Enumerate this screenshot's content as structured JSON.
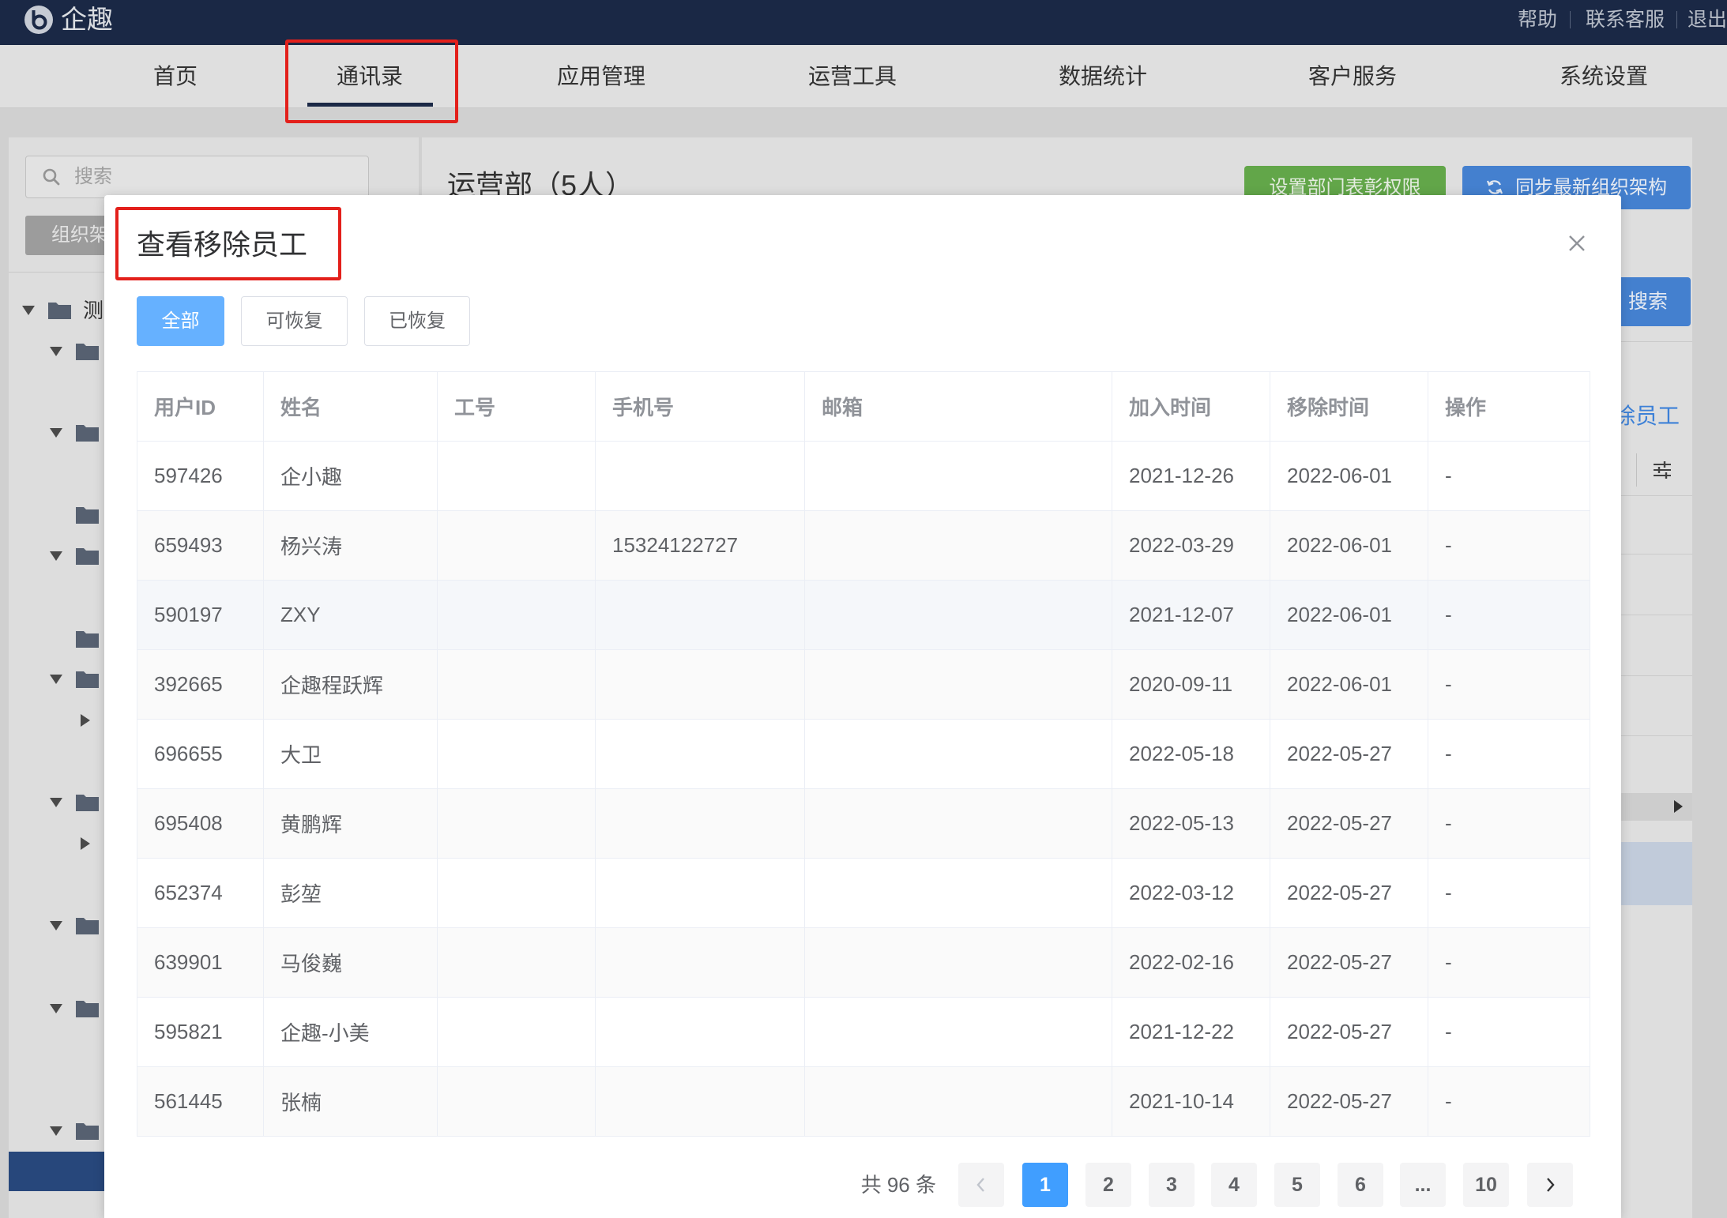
{
  "header": {
    "logo_text": "企趣",
    "links": [
      "帮助",
      "联系客服",
      "退出"
    ]
  },
  "nav": {
    "items": [
      "首页",
      "通讯录",
      "应用管理",
      "运营工具",
      "数据统计",
      "客户服务",
      "系统设置"
    ],
    "active_index": 1
  },
  "sidebar": {
    "search_placeholder": "搜索",
    "tab_label": "组织架",
    "tree_root_label": "测"
  },
  "main": {
    "title": "运营部（5人）",
    "permission_button": "设置部门表彰权限",
    "sync_button": "同步最新组织架构",
    "search_button": "搜索",
    "removed_link": "除员工"
  },
  "modal": {
    "title": "查看移除员工",
    "filters": [
      "全部",
      "可恢复",
      "已恢复"
    ],
    "active_filter_index": 0,
    "table": {
      "columns": [
        "用户ID",
        "姓名",
        "工号",
        "手机号",
        "邮箱",
        "加入时间",
        "移除时间",
        "操作"
      ],
      "rows": [
        [
          "597426",
          "企小趣",
          "",
          "",
          "",
          "2021-12-26",
          "2022-06-01",
          "-"
        ],
        [
          "659493",
          "杨兴涛",
          "",
          "15324122727",
          "",
          "2022-03-29",
          "2022-06-01",
          "-"
        ],
        [
          "590197",
          "ZXY",
          "",
          "",
          "",
          "2021-12-07",
          "2022-06-01",
          "-"
        ],
        [
          "392665",
          "企趣程跃辉",
          "",
          "",
          "",
          "2020-09-11",
          "2022-06-01",
          "-"
        ],
        [
          "696655",
          "大卫",
          "",
          "",
          "",
          "2022-05-18",
          "2022-05-27",
          "-"
        ],
        [
          "695408",
          "黄鹏辉",
          "",
          "",
          "",
          "2022-05-13",
          "2022-05-27",
          "-"
        ],
        [
          "652374",
          "彭堃",
          "",
          "",
          "",
          "2022-03-12",
          "2022-05-27",
          "-"
        ],
        [
          "639901",
          "马俊巍",
          "",
          "",
          "",
          "2022-02-16",
          "2022-05-27",
          "-"
        ],
        [
          "595821",
          "企趣-小美",
          "",
          "",
          "",
          "2021-12-22",
          "2022-05-27",
          "-"
        ],
        [
          "561445",
          "张楠",
          "",
          "",
          "",
          "2021-10-14",
          "2022-05-27",
          "-"
        ]
      ]
    },
    "pagination": {
      "total_text": "共 96 条",
      "pages": [
        "1",
        "2",
        "3",
        "4",
        "5",
        "6",
        "...",
        "10"
      ],
      "current_page": "1"
    }
  },
  "icons": {
    "logo": "logo-icon",
    "search": "search-icon",
    "folder": "folder-icon",
    "refresh": "refresh-icon",
    "filter": "sliders-icon",
    "close": "close-icon",
    "prev": "chevron-left-icon",
    "next": "chevron-right-icon"
  },
  "colors": {
    "topbar": "#1c2a48",
    "accent": "#409eff",
    "active_filter": "#66b1ff",
    "success_button": "#67ad4c",
    "primary_button": "#4786d8",
    "annotation": "#e3201b",
    "selected_tree_item": "#294a80"
  }
}
